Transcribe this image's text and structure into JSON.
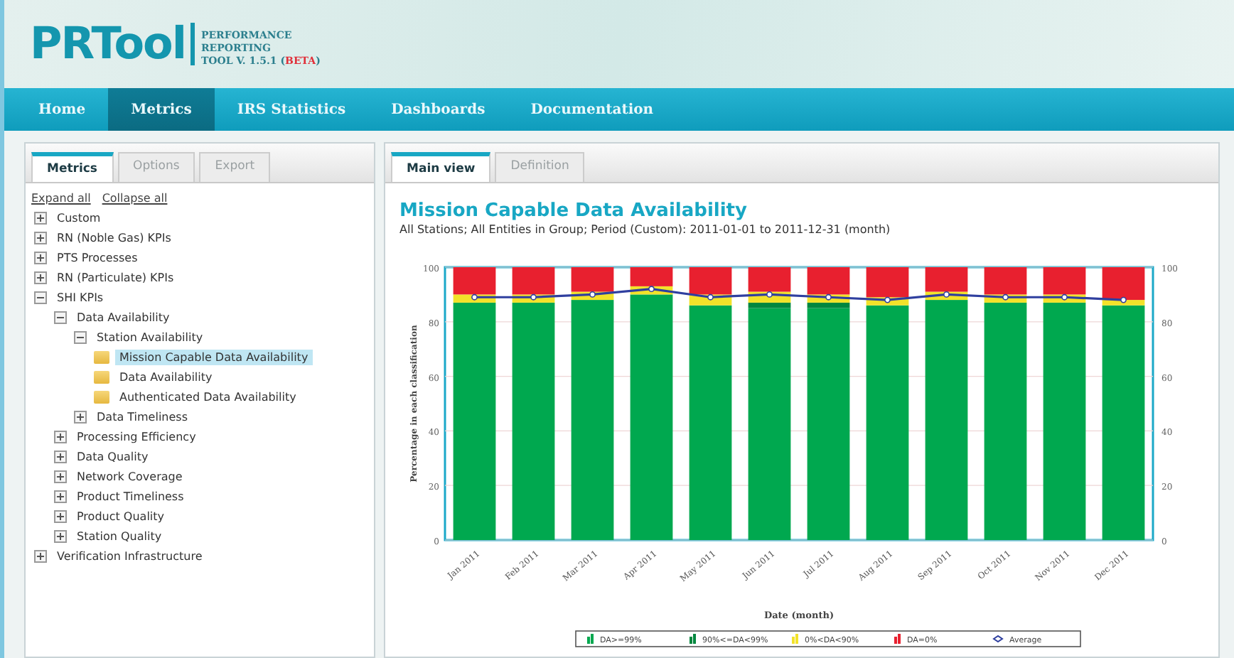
{
  "header": {
    "logo": "PRTool",
    "tagline_lines": [
      "PERFORMANCE",
      "REPORTING"
    ],
    "tagline_tool": "TOOL  V. 1.5.1 (",
    "tagline_beta": "BETA",
    "tagline_end": ")"
  },
  "nav": [
    {
      "label": "Home",
      "selected": false
    },
    {
      "label": "Metrics",
      "selected": true
    },
    {
      "label": "IRS Statistics",
      "selected": false
    },
    {
      "label": "Dashboards",
      "selected": false
    },
    {
      "label": "Documentation",
      "selected": false
    }
  ],
  "left_panel": {
    "tabs": [
      {
        "label": "Metrics",
        "selected": true
      },
      {
        "label": "Options",
        "selected": false
      },
      {
        "label": "Export",
        "selected": false
      }
    ],
    "links": [
      "Expand all",
      "Collapse all"
    ],
    "tree": [
      {
        "kind": "group",
        "label": "Custom",
        "expanded": false
      },
      {
        "kind": "group",
        "label": "RN (Noble Gas) KPIs",
        "expanded": false
      },
      {
        "kind": "group",
        "label": "PTS Processes",
        "expanded": false
      },
      {
        "kind": "group",
        "label": "RN (Particulate) KPIs",
        "expanded": false
      },
      {
        "kind": "group",
        "label": "SHI KPIs",
        "expanded": true,
        "children": [
          {
            "kind": "group",
            "label": "Data Availability",
            "expanded": true,
            "children": [
              {
                "kind": "group",
                "label": "Station Availability",
                "expanded": true,
                "children": [
                  {
                    "kind": "leaf",
                    "label": "Mission Capable Data Availability",
                    "selected": true
                  },
                  {
                    "kind": "leaf",
                    "label": "Data Availability",
                    "selected": false
                  },
                  {
                    "kind": "leaf",
                    "label": "Authenticated Data Availability",
                    "selected": false
                  }
                ]
              },
              {
                "kind": "group",
                "label": "Data Timeliness",
                "expanded": false
              }
            ]
          },
          {
            "kind": "group",
            "label": "Processing Efficiency",
            "expanded": false
          },
          {
            "kind": "group",
            "label": "Data Quality",
            "expanded": false
          },
          {
            "kind": "group",
            "label": "Network Coverage",
            "expanded": false
          },
          {
            "kind": "group",
            "label": "Product Timeliness",
            "expanded": false
          },
          {
            "kind": "group",
            "label": "Product Quality",
            "expanded": false
          },
          {
            "kind": "group",
            "label": "Station Quality",
            "expanded": false
          }
        ]
      },
      {
        "kind": "group",
        "label": "Verification Infrastructure",
        "expanded": false
      }
    ]
  },
  "main_panel": {
    "tabs": [
      {
        "label": "Main view",
        "selected": true
      },
      {
        "label": "Definition",
        "selected": false
      }
    ],
    "title": "Mission Capable Data Availability",
    "subtitle": "All Stations; All Entities in Group; Period (Custom): 2011-01-01 to 2011-12-31 (month)",
    "chart_data": {
      "type": "bar",
      "stacked": true,
      "xlabel": "Date (month)",
      "ylabel": "Percentage in each classification",
      "categories": [
        "Jan 2011",
        "Feb 2011",
        "Mar 2011",
        "Apr 2011",
        "May 2011",
        "Jun 2011",
        "Jul 2011",
        "Aug 2011",
        "Sep 2011",
        "Oct 2011",
        "Nov 2011",
        "Dec 2011"
      ],
      "ylim": [
        0,
        100
      ],
      "yticks": [
        0,
        20,
        40,
        60,
        80,
        100
      ],
      "y2lim": [
        0,
        100
      ],
      "y2ticks": [
        0,
        20,
        40,
        60,
        80,
        100
      ],
      "grid": true,
      "legend": "bottom",
      "series": [
        {
          "name": "DA>=99%",
          "type": "bar",
          "color": "#00a84f",
          "values": [
            87,
            87,
            88,
            90,
            86,
            85,
            85,
            86,
            88,
            87,
            87,
            86
          ]
        },
        {
          "name": "90%<=DA<99%",
          "type": "bar",
          "color": "#00873f",
          "values": [
            0,
            0,
            0,
            0,
            0,
            2,
            2,
            0,
            0,
            0,
            0,
            0
          ]
        },
        {
          "name": "0%<DA<90%",
          "type": "bar",
          "color": "#f2e22a",
          "values": [
            3,
            3,
            3,
            3,
            4,
            4,
            3,
            3,
            3,
            3,
            3,
            2
          ]
        },
        {
          "name": "DA=0%",
          "type": "bar",
          "color": "#e8202f",
          "values": [
            10,
            10,
            9,
            7,
            10,
            9,
            10,
            11,
            9,
            10,
            10,
            12
          ]
        },
        {
          "name": "Average",
          "type": "line",
          "marker": "circle",
          "color": "#2f3f9f",
          "values": [
            89,
            89,
            90,
            92,
            89,
            90,
            89,
            88,
            90,
            89,
            89,
            88
          ]
        }
      ]
    }
  }
}
